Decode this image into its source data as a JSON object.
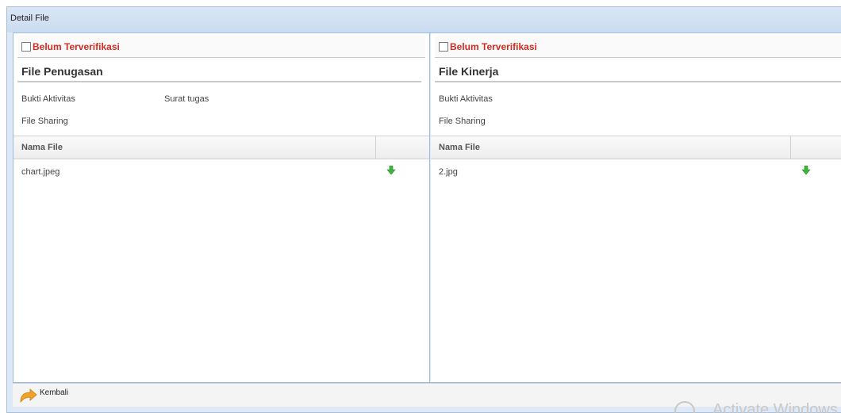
{
  "window": {
    "title": "Detail File"
  },
  "left_panel": {
    "status_label": "Belum Terverifikasi",
    "section_title": "File Penugasan",
    "fields": [
      {
        "label": "Bukti Aktivitas",
        "value": "Surat tugas"
      },
      {
        "label": "File Sharing",
        "value": ""
      }
    ],
    "grid": {
      "column_header": "Nama File",
      "rows": [
        {
          "name": "chart.jpeg"
        }
      ]
    }
  },
  "right_panel": {
    "status_label": "Belum Terverifikasi",
    "section_title": "File Kinerja",
    "fields": [
      {
        "label": "Bukti Aktivitas",
        "value": ""
      },
      {
        "label": "File Sharing",
        "value": ""
      }
    ],
    "grid": {
      "column_header": "Nama File",
      "rows": [
        {
          "name": "2.jpg"
        }
      ]
    }
  },
  "footer": {
    "back_label": "Kembali"
  },
  "overlay": {
    "watermark_text": "Activate Windows"
  },
  "colors": {
    "status_red": "#d22b20",
    "download_green": "#3cb53c",
    "back_icon_orange": "#f0a22a"
  },
  "icons": {
    "download": "download-arrow-icon",
    "back": "back-arrow-icon",
    "checkbox": "checkbox-icon"
  }
}
